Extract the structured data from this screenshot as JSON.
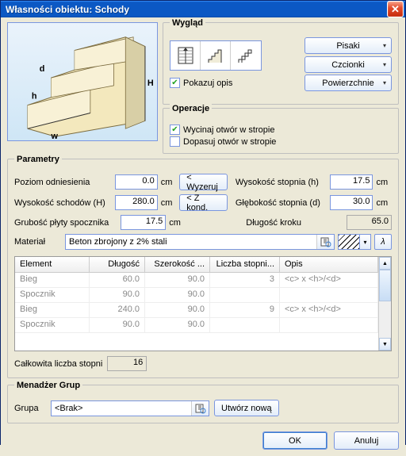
{
  "window": {
    "title": "Własności obiektu: Schody"
  },
  "wyglad": {
    "legend": "Wygląd",
    "pisaki": "Pisaki",
    "czcionki": "Czcionki",
    "powierzchnie": "Powierzchnie",
    "pokazuj_opis": "Pokazuj opis",
    "pokazuj_checked": "✔"
  },
  "operacje": {
    "legend": "Operacje",
    "wycinaj": "Wycinaj otwór w stropie",
    "wycinaj_checked": "✔",
    "dopasuj": "Dopasuj otwór w stropie",
    "dopasuj_checked": ""
  },
  "params": {
    "legend": "Parametry",
    "poziom_label": "Poziom odniesienia",
    "poziom_value": "0.0",
    "wyzeruj": "< Wyzeruj",
    "wysokosc_schodow_label": "Wysokość schodów (H)",
    "wysokosc_schodow_value": "280.0",
    "zkond": "< Z kond.",
    "grubosc_label": "Grubość płyty spocznika",
    "grubosc_value": "17.5",
    "wysokosc_stopnia_label": "Wysokość stopnia (h)",
    "wysokosc_stopnia_value": "17.5",
    "glebokosc_stopnia_label": "Głębokość stopnia (d)",
    "glebokosc_stopnia_value": "30.0",
    "dlugosc_kroku_label": "Długość kroku",
    "dlugosc_kroku_value": "65.0",
    "cm": "cm",
    "material_label": "Materiał",
    "material_value": "Beton zbrojony z 2% stali",
    "lambda": "λ"
  },
  "grid": {
    "headers": {
      "element": "Element",
      "dlugosc": "Długość",
      "szerokosc": "Szerokość ...",
      "liczba": "Liczba stopni...",
      "opis": "Opis"
    },
    "rows": [
      {
        "element": "Bieg",
        "dlugosc": "60.0",
        "szerokosc": "90.0",
        "liczba": "3",
        "opis": "<c> x <h>/<d>"
      },
      {
        "element": "Spocznik",
        "dlugosc": "90.0",
        "szerokosc": "90.0",
        "liczba": "",
        "opis": ""
      },
      {
        "element": "Bieg",
        "dlugosc": "240.0",
        "szerokosc": "90.0",
        "liczba": "9",
        "opis": "<c> x <h>/<d>"
      },
      {
        "element": "Spocznik",
        "dlugosc": "90.0",
        "szerokosc": "90.0",
        "liczba": "",
        "opis": ""
      }
    ],
    "total_label": "Całkowita liczba stopni",
    "total_value": "16"
  },
  "groups": {
    "legend": "Menadżer Grup",
    "grupa_label": "Grupa",
    "grupa_value": "<Brak>",
    "new_btn": "Utwórz nową"
  },
  "footer": {
    "ok": "OK",
    "cancel": "Anuluj"
  },
  "diagram": {
    "d": "d",
    "h": "h",
    "w": "w",
    "H": "H"
  }
}
